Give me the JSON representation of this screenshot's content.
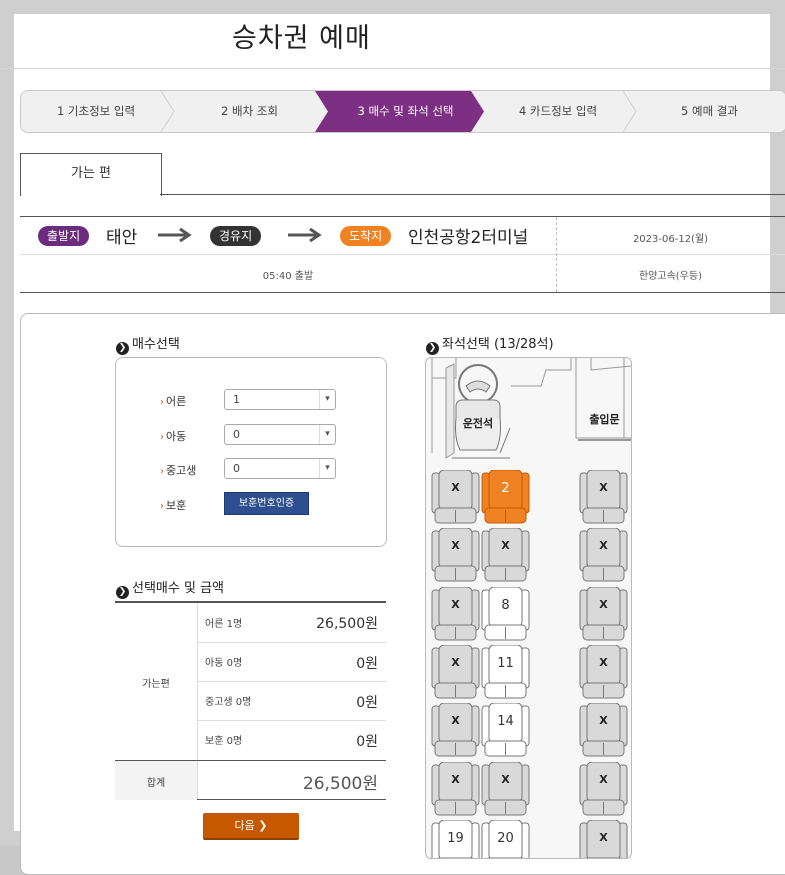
{
  "page": {
    "title": "승차권 예매"
  },
  "steps": [
    {
      "label": "1 기초정보 입력",
      "active": false
    },
    {
      "label": "2 배차 조회",
      "active": false
    },
    {
      "label": "3 매수 및 좌석 선택",
      "active": true
    },
    {
      "label": "4 카드정보 입력",
      "active": false
    },
    {
      "label": "5 예매 결과",
      "active": false
    }
  ],
  "tab": {
    "label": "가는 편"
  },
  "route": {
    "origin_badge": "출발지",
    "origin": "태안",
    "via_badge": "경유지",
    "dest_badge": "도착지",
    "destination": "인천공항2터미널",
    "date": "2023-06-12(월)",
    "departure": "05:40 출발",
    "company": "한양고속(우등)"
  },
  "quantity": {
    "heading": "매수선택",
    "rows": [
      {
        "label": "어른",
        "value": "1"
      },
      {
        "label": "아동",
        "value": "0"
      },
      {
        "label": "중고생",
        "value": "0"
      }
    ],
    "veteran_label": "보훈",
    "veteran_button": "보훈번호인증"
  },
  "price": {
    "heading": "선택매수 및 금액",
    "group_label": "가는편",
    "rows": [
      {
        "label": "어른 1명",
        "value": "26,500원"
      },
      {
        "label": "아동 0명",
        "value": "0원"
      },
      {
        "label": "중고생 0명",
        "value": "0원"
      },
      {
        "label": "보훈 0명",
        "value": "0원"
      }
    ],
    "total_label": "합계",
    "total_value": "26,500원"
  },
  "next_button": "다음 ❯",
  "seatmap": {
    "heading": "좌석선택 (13/28석)",
    "driver_label": "운전석",
    "door_label": "출입문",
    "rows": [
      [
        "X",
        "2",
        "X"
      ],
      [
        "X",
        "X",
        "X"
      ],
      [
        "X",
        "8",
        "X"
      ],
      [
        "X",
        "11",
        "X"
      ],
      [
        "X",
        "14",
        "X"
      ],
      [
        "X",
        "X",
        "X"
      ],
      [
        "19",
        "20",
        "X"
      ]
    ],
    "selected_seat": "2",
    "colors": {
      "selected": "#f08224",
      "available": "#ffffff",
      "taken": "#d9d9d9"
    }
  },
  "colors": {
    "active_step": "#7d2f84",
    "origin_badge": "#6b2c7d",
    "via_badge": "#333333",
    "dest_badge": "#f08224"
  }
}
